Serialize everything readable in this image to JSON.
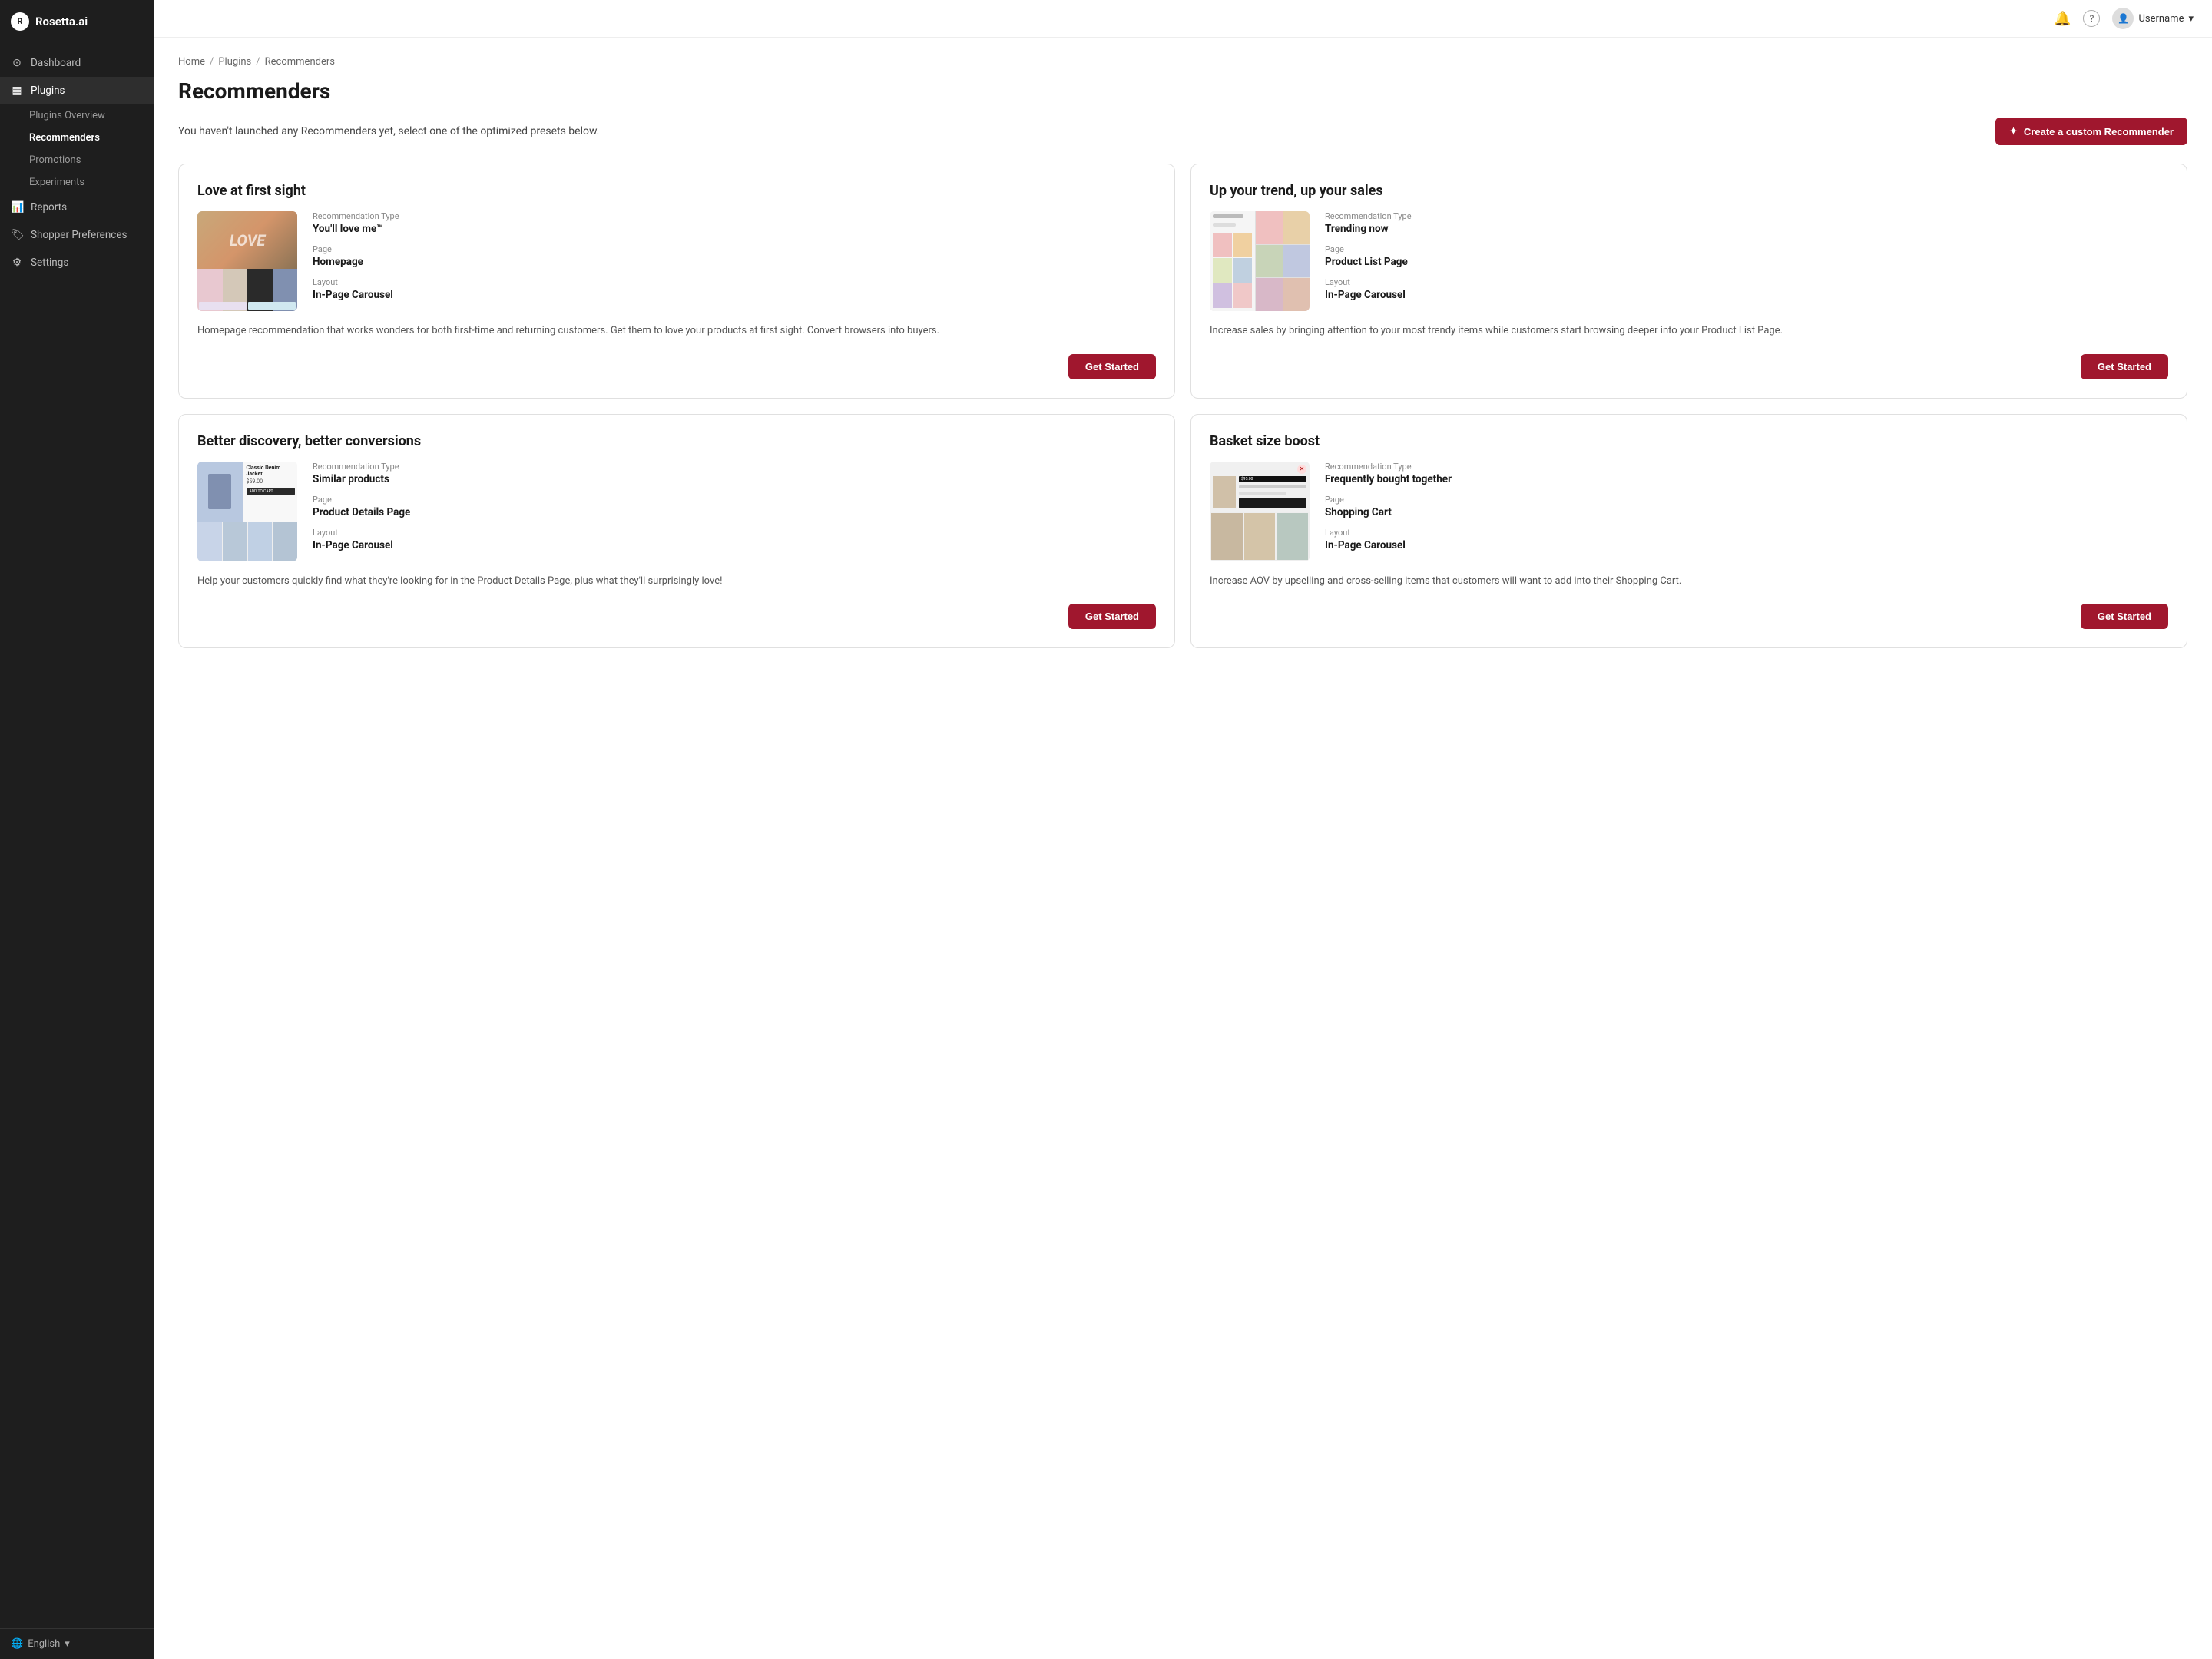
{
  "sidebar": {
    "logo": "Rosetta.ai",
    "nav": [
      {
        "id": "dashboard",
        "label": "Dashboard",
        "icon": "⊙",
        "active": false
      },
      {
        "id": "plugins",
        "label": "Plugins",
        "icon": "▦",
        "active": true
      }
    ],
    "plugins_sub": [
      {
        "id": "plugins-overview",
        "label": "Plugins Overview",
        "active": false
      },
      {
        "id": "recommenders",
        "label": "Recommenders",
        "active": true
      },
      {
        "id": "promotions",
        "label": "Promotions",
        "active": false
      },
      {
        "id": "experiments",
        "label": "Experiments",
        "active": false
      }
    ],
    "nav2": [
      {
        "id": "reports",
        "label": "Reports",
        "icon": "📊",
        "active": false
      },
      {
        "id": "shopper-preferences",
        "label": "Shopper Preferences",
        "icon": "🏷",
        "active": false
      },
      {
        "id": "settings",
        "label": "Settings",
        "icon": "⚙",
        "active": false
      }
    ],
    "footer": {
      "language": "English",
      "icon": "🌐"
    }
  },
  "topbar": {
    "notification_icon": "🔔",
    "help_icon": "?",
    "username": "Username"
  },
  "breadcrumb": {
    "items": [
      "Home",
      "Plugins",
      "Recommenders"
    ],
    "separators": [
      "/",
      "/"
    ]
  },
  "page": {
    "title": "Recommenders",
    "subtitle": "You haven't launched any Recommenders yet, select one of the optimized presets below.",
    "create_button": "Create a custom Recommender"
  },
  "cards": [
    {
      "id": "love-at-first-sight",
      "title": "Love at first sight",
      "recommendation_type_label": "Recommendation Type",
      "recommendation_type": "You'll love me™",
      "page_label": "Page",
      "page": "Homepage",
      "layout_label": "Layout",
      "layout": "In-Page Carousel",
      "description": "Homepage recommendation that works wonders for both first-time and returning customers. Get them to love your products at first sight. Convert browsers into buyers.",
      "cta": "Get Started"
    },
    {
      "id": "up-your-trend",
      "title": "Up your trend, up your sales",
      "recommendation_type_label": "Recommendation Type",
      "recommendation_type": "Trending now",
      "page_label": "Page",
      "page": "Product List Page",
      "layout_label": "Layout",
      "layout": "In-Page Carousel",
      "description": "Increase sales by bringing attention to your most trendy items while customers start browsing deeper into your Product List Page.",
      "cta": "Get Started"
    },
    {
      "id": "better-discovery",
      "title": "Better discovery, better conversions",
      "recommendation_type_label": "Recommendation Type",
      "recommendation_type": "Similar products",
      "page_label": "Page",
      "page": "Product Details Page",
      "layout_label": "Layout",
      "layout": "In-Page Carousel",
      "description": "Help your customers quickly find what they're looking for in the Product Details Page, plus what they'll surprisingly love!",
      "cta": "Get Started"
    },
    {
      "id": "basket-size-boost",
      "title": "Basket size boost",
      "recommendation_type_label": "Recommendation Type",
      "recommendation_type": "Frequently bought together",
      "page_label": "Page",
      "page": "Shopping Cart",
      "layout_label": "Layout",
      "layout": "In-Page Carousel",
      "description": "Increase AOV by upselling and cross-selling items that customers will want to add into their Shopping Cart.",
      "cta": "Get Started"
    }
  ]
}
